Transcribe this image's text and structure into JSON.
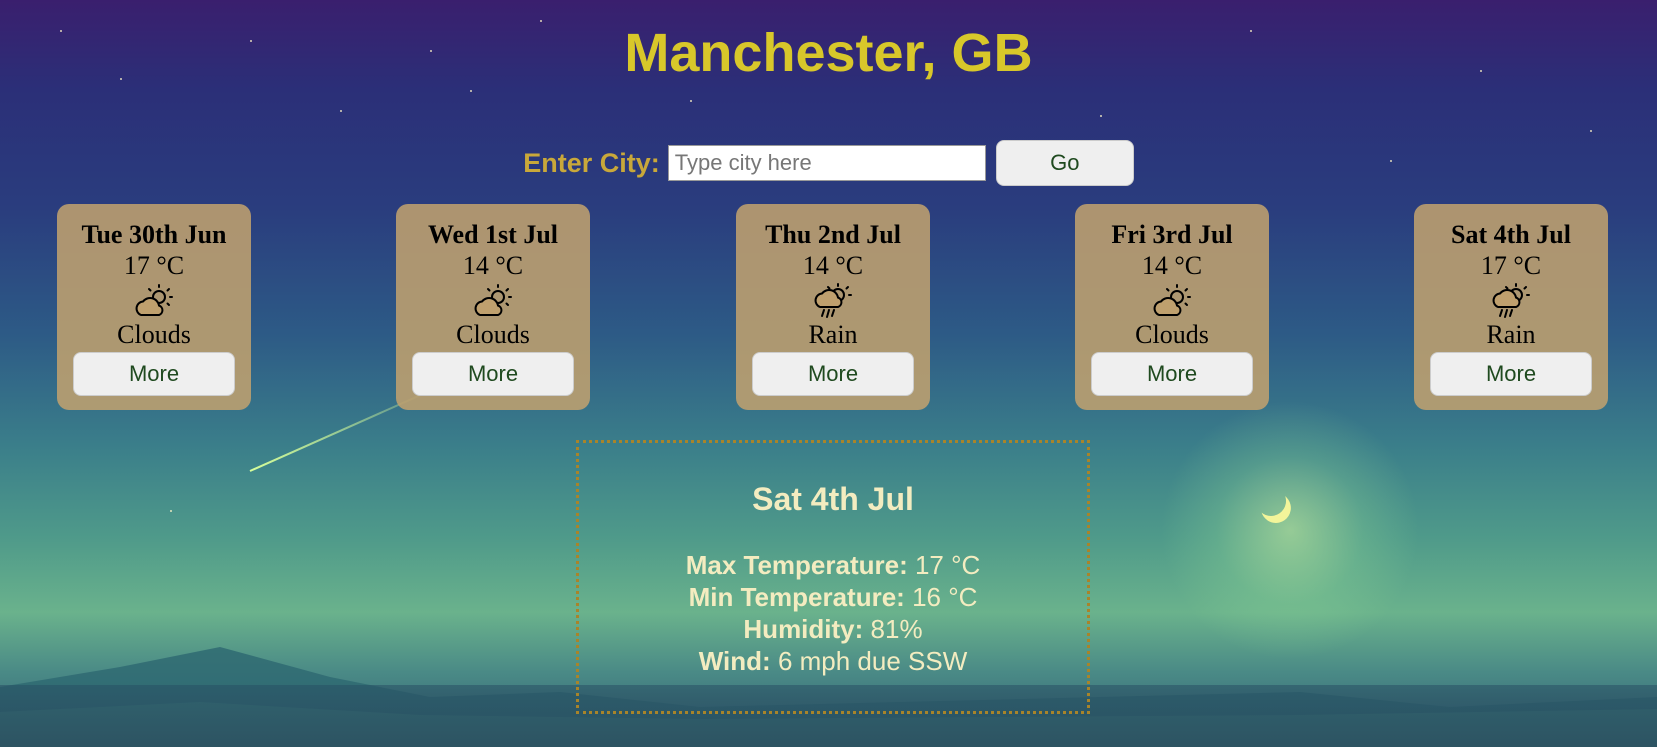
{
  "header": {
    "title": "Manchester, GB"
  },
  "search": {
    "label": "Enter City:",
    "placeholder": "Type city here",
    "value": "",
    "go_label": "Go"
  },
  "forecast": [
    {
      "date": "Tue 30th Jun",
      "temp": "17 °C",
      "icon": "partly-cloudy-icon",
      "desc": "Clouds",
      "more_label": "More"
    },
    {
      "date": "Wed 1st Jul",
      "temp": "14 °C",
      "icon": "partly-cloudy-icon",
      "desc": "Clouds",
      "more_label": "More"
    },
    {
      "date": "Thu 2nd Jul",
      "temp": "14 °C",
      "icon": "rain-icon",
      "desc": "Rain",
      "more_label": "More"
    },
    {
      "date": "Fri 3rd Jul",
      "temp": "14 °C",
      "icon": "partly-cloudy-icon",
      "desc": "Clouds",
      "more_label": "More"
    },
    {
      "date": "Sat 4th Jul",
      "temp": "17 °C",
      "icon": "rain-icon",
      "desc": "Rain",
      "more_label": "More"
    }
  ],
  "details": {
    "date": "Sat 4th Jul",
    "max_label": "Max Temperature:",
    "max_value": "17 °C",
    "min_label": "Min Temperature:",
    "min_value": "16 °C",
    "humidity_label": "Humidity:",
    "humidity_value": "81%",
    "wind_label": "Wind:",
    "wind_value": "6 mph due SSW"
  },
  "colors": {
    "title": "#d8c72a",
    "label": "#c9a83a",
    "card_bg": "#bfa06e",
    "details_border": "#a8842a",
    "details_text": "#f3ecc0"
  }
}
